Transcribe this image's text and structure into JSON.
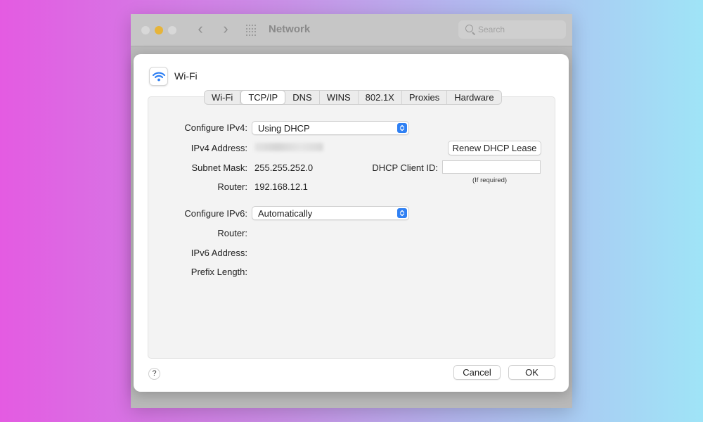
{
  "window": {
    "title": "Network",
    "search_placeholder": "Search"
  },
  "sheet": {
    "title": "Wi-Fi",
    "icon": "wifi-icon",
    "tabs": [
      {
        "label": "Wi-Fi"
      },
      {
        "label": "TCP/IP",
        "active": true
      },
      {
        "label": "DNS"
      },
      {
        "label": "WINS"
      },
      {
        "label": "802.1X"
      },
      {
        "label": "Proxies"
      },
      {
        "label": "Hardware"
      }
    ]
  },
  "ipv4": {
    "configure_label": "Configure IPv4:",
    "configure_value": "Using DHCP",
    "address_label": "IPv4 Address:",
    "subnet_label": "Subnet Mask:",
    "subnet_value": "255.255.252.0",
    "router_label": "Router:",
    "router_value": "192.168.12.1",
    "renew_button": "Renew DHCP Lease",
    "client_id_label": "DHCP Client ID:",
    "client_id_value": "",
    "client_id_hint": "(If required)"
  },
  "ipv6": {
    "configure_label": "Configure IPv6:",
    "configure_value": "Automatically",
    "router_label": "Router:",
    "address_label": "IPv6 Address:",
    "prefix_label": "Prefix Length:"
  },
  "footer": {
    "help": "?",
    "cancel": "Cancel",
    "ok": "OK"
  },
  "colors": {
    "accent": "#2f80f3",
    "minimize": "#e6b43a"
  }
}
